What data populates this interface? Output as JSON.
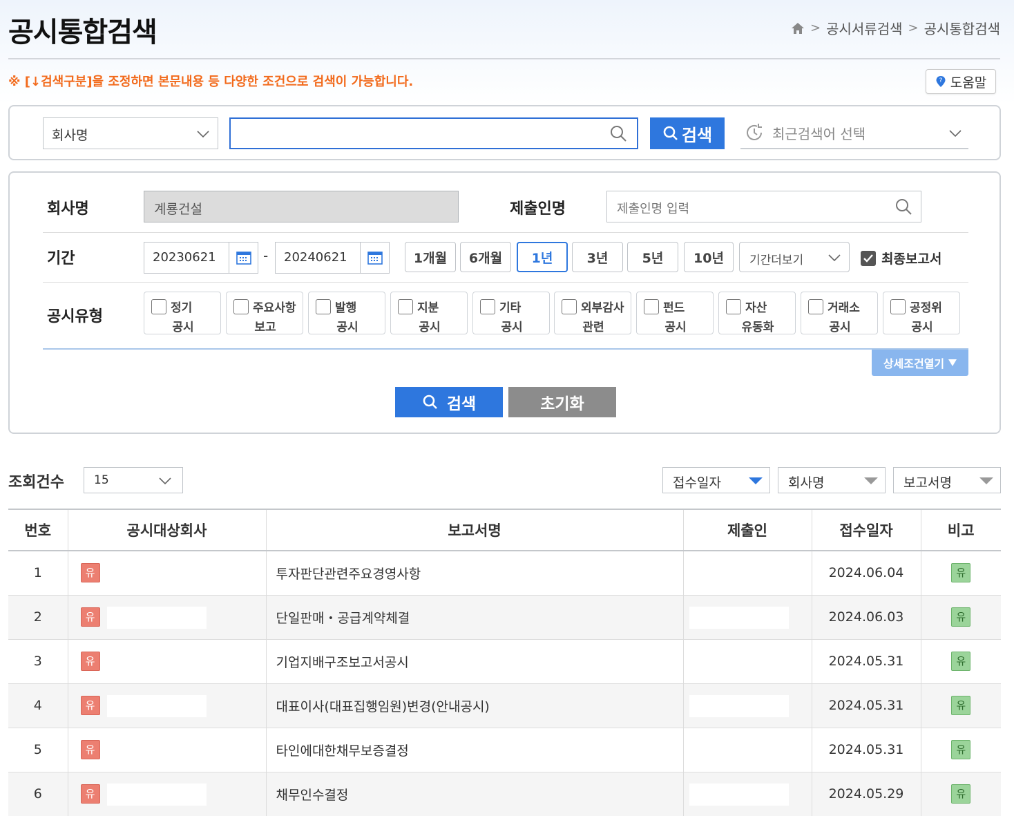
{
  "header": {
    "title": "공시통합검색",
    "breadcrumb": [
      "공시서류검색",
      "공시통합검색"
    ]
  },
  "notice": "※ [↓검색구분]을 조정하면 본문내용 등 다양한 조건으로 검색이 가능합니다.",
  "help_label": "도움말",
  "search": {
    "category": "회사명",
    "query": "",
    "button": "검색",
    "recent_placeholder": "최근검색어 선택"
  },
  "conditions": {
    "company_label": "회사명",
    "company_value": "계룡건설",
    "submitter_label": "제출인명",
    "submitter_placeholder": "제출인명 입력",
    "period_label": "기간",
    "date_from": "20230621",
    "date_to": "20240621",
    "date_sep": "-",
    "periods": [
      "1개월",
      "6개월",
      "1년",
      "3년",
      "5년",
      "10년"
    ],
    "active_period": "1년",
    "more_period": "기간더보기",
    "final_report": "최종보고서",
    "final_report_checked": true,
    "type_label": "공시유형",
    "types": [
      {
        "l1": "정기",
        "l2": "공시"
      },
      {
        "l1": "주요사항",
        "l2": "보고"
      },
      {
        "l1": "발행",
        "l2": "공시"
      },
      {
        "l1": "지분",
        "l2": "공시"
      },
      {
        "l1": "기타",
        "l2": "공시"
      },
      {
        "l1": "외부감사",
        "l2": "관련"
      },
      {
        "l1": "펀드",
        "l2": "공시"
      },
      {
        "l1": "자산",
        "l2": "유동화"
      },
      {
        "l1": "거래소",
        "l2": "공시"
      },
      {
        "l1": "공정위",
        "l2": "공시"
      }
    ],
    "detail_toggle": "상세조건열기",
    "search_button": "검색",
    "reset_button": "초기화"
  },
  "list": {
    "count_label": "조회건수",
    "count_value": "15",
    "sort": [
      "접수일자",
      "회사명",
      "보고서명"
    ],
    "columns": [
      "번호",
      "공시대상회사",
      "보고서명",
      "제출인",
      "접수일자",
      "비고"
    ],
    "badge_company": "유",
    "badge_note": "유",
    "rows": [
      {
        "num": "1",
        "report": "투자판단관련주요경영사항",
        "date": "2024.06.04"
      },
      {
        "num": "2",
        "report": "단일판매・공급계약체결",
        "date": "2024.06.03"
      },
      {
        "num": "3",
        "report": "기업지배구조보고서공시",
        "date": "2024.05.31"
      },
      {
        "num": "4",
        "report": "대표이사(대표집행임원)변경(안내공시)",
        "date": "2024.05.31"
      },
      {
        "num": "5",
        "report": "타인에대한채무보증결정",
        "date": "2024.05.31"
      },
      {
        "num": "6",
        "report": "채무인수결정",
        "date": "2024.05.29"
      }
    ]
  },
  "colors": {
    "accent": "#2e77de",
    "notice": "#f26a1b",
    "badge_company": "#ec7f71",
    "badge_note": "#9bd49a"
  }
}
